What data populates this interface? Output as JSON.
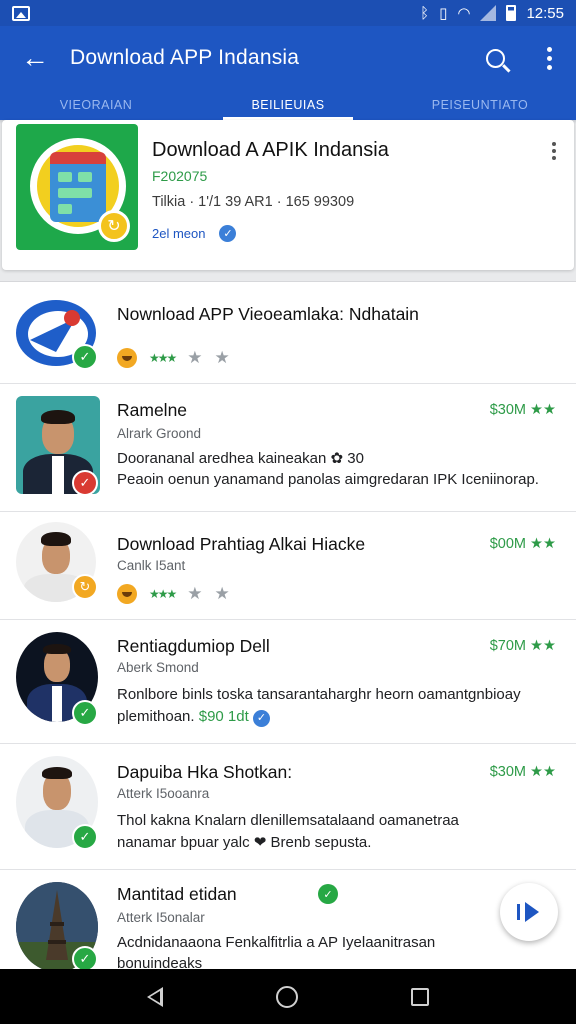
{
  "status_bar": {
    "time": "12:55",
    "icons": [
      "gallery-icon",
      "bluetooth-icon",
      "vibrate-icon",
      "wifi-icon",
      "signal-icon",
      "battery-icon"
    ]
  },
  "app_bar": {
    "title": "Download APP Indansia",
    "back_icon": "arrow-left-icon",
    "search_icon": "search-icon",
    "menu_icon": "more-vert-icon"
  },
  "tabs": [
    {
      "label": "VIEORAIAN",
      "active": false
    },
    {
      "label": "BEILIEUIAS",
      "active": true
    },
    {
      "label": "PEISEUNTIATO",
      "active": false
    }
  ],
  "featured": {
    "name": "Download A APIK Indansia",
    "developer": "F202075",
    "meta": "Tilkia · 1'/1  39  AR1 · 165 99309",
    "size": "2el meon",
    "verified_icon": "check-badge-icon"
  },
  "list": [
    {
      "name": "Nownload APP Vieoeamlaka: Ndhatain",
      "rating_icons": [
        "emoji-icon",
        "stars-icon",
        "star-icon",
        "star-icon"
      ]
    },
    {
      "name": "Ramelne",
      "sub": "Alrark  Groond",
      "price": "$30M ★★",
      "desc1": "Doorananal aredhea kaineakan ✿ 30",
      "desc2": "Peaoin oenun yanamand panolas aimgredaran IPK Iceniinorap."
    },
    {
      "name": "Download Prahtiag Alkai Hiacke",
      "sub": "Canlk  I5ant",
      "price": "$00M ★★",
      "rating_icons": [
        "emoji-icon",
        "stars-icon",
        "star-icon",
        "star-icon"
      ]
    },
    {
      "name": "Rentiagdumiop Dell",
      "sub": "Aberk  Smond",
      "price": "$70M ★★",
      "desc1": "Ronlbore binls toska tansarantaharghr heorn oamantgnbioay",
      "desc2": "plemithoan.",
      "desc2_link": "$90 1dt"
    },
    {
      "name": "Dapuiba Hka Shotkan:",
      "sub": "Atterk  I5ooanra",
      "price": "$30M ★★",
      "desc1": "Thol kakna Knalarn dlenillemsatalaand oamanetraa",
      "desc2": "nanamar bpuar yalc ❤ Brenb sepusta."
    },
    {
      "name": "Mantitad etidan",
      "sub": "Atterk  I5onalar",
      "desc1": "Acdnidanaaona Fenkalfitrlia a AP Iyelaanitrasan",
      "desc2": "bonuindeaks"
    }
  ],
  "colors": {
    "primary": "#1e56c2",
    "accent_green": "#2e9b48",
    "badge_red": "#d93a32",
    "badge_orange": "#f2a822"
  }
}
